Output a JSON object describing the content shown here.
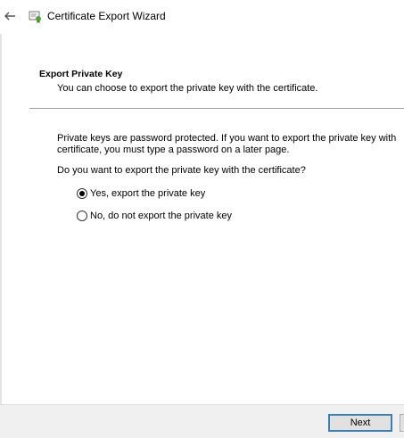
{
  "window": {
    "title": "Certificate Export Wizard"
  },
  "page": {
    "heading": "Export Private Key",
    "description": "You can choose to export the private key with the certificate.",
    "body_line1": "Private keys are password protected. If you want to export the private key with",
    "body_line2": "certificate, you must type a password on a later page.",
    "question": "Do you want to export the private key with the certificate?"
  },
  "options": [
    {
      "label": "Yes, export the private key",
      "selected": true
    },
    {
      "label": "No, do not export the private key",
      "selected": false
    }
  ],
  "footer": {
    "next_label": "Next"
  },
  "icons": {
    "back": "back-arrow-icon",
    "app": "certificate-icon"
  }
}
